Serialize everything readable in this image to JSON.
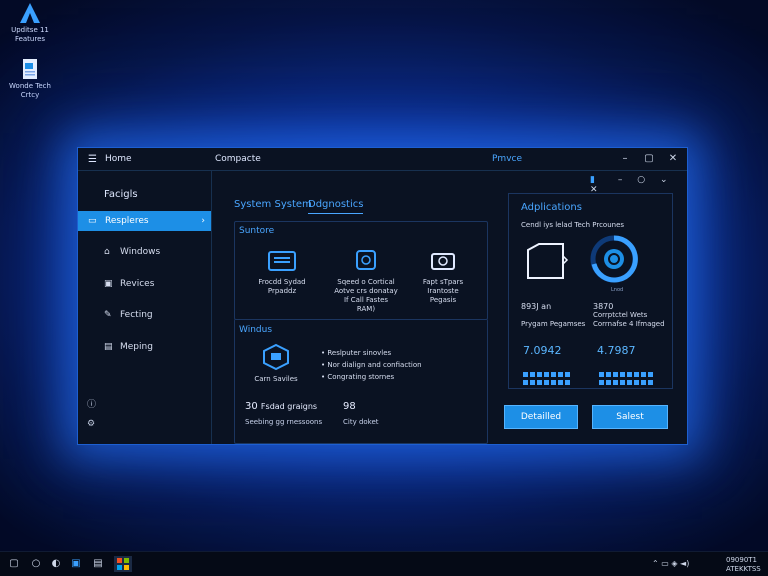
{
  "desktop": {
    "icons": [
      {
        "label1": "Upditse 11",
        "label2": "Features"
      },
      {
        "label1": "Wonde Tech",
        "label2": "Crtcy"
      }
    ]
  },
  "window": {
    "title_left": "Home",
    "title_center": "Compacte",
    "title_right": "Pmvce"
  },
  "sidebar": {
    "heading": "Facigls",
    "items": [
      {
        "label": "Respleres"
      },
      {
        "label": "Windows"
      },
      {
        "label": "Revices"
      },
      {
        "label": "Fecting"
      },
      {
        "label": "Meping"
      }
    ]
  },
  "main": {
    "tabs": [
      "System System",
      "Ddgnostics"
    ],
    "card1": {
      "title": "Suntore",
      "items": [
        {
          "line1": "Frocdd Sydad",
          "line2": "Prpaddz",
          "line3": ""
        },
        {
          "line1": "Sqeed o Cortical",
          "line2": "Aotve crs donatay",
          "line3": "If Call Fastes",
          "line4": "RAM)"
        },
        {
          "line1": "Fapt sTpars",
          "line2": "Irantoste",
          "line3": "Pegasis"
        }
      ]
    },
    "card2": {
      "title": "Windus",
      "icon_label": "Carn Saviles",
      "bullets": [
        "Reslputer sinovles",
        "Nor dialign and confiaction",
        "Congrating stornes"
      ],
      "stat1_num": "30",
      "stat1_text": "Fsdad graigns",
      "stat1_sub": "Seebing gg rnessoons",
      "stat2_num": "98",
      "stat2_sub": "City doket"
    }
  },
  "applications": {
    "heading": "Adplications",
    "subheading": "Cendl iys lelad Tech Prcounes",
    "ring_label": "Lnod",
    "left_num": "893J an",
    "left_sub": "Prygam Pegamses",
    "right_num": "3870",
    "right_sub1": "Corrptctel Wets",
    "right_sub2": "Corrnafse 4 Ifmaged",
    "big_left": "7.0942",
    "big_right": "4.7987",
    "btn_left": "Detailled",
    "btn_right": "Salest"
  },
  "tray": {
    "time": "09090T1",
    "date": "ATEKKTSS"
  },
  "colors": {
    "accent": "#1d8fe6",
    "link": "#4aa6ff",
    "window_bg": "#0a1222"
  }
}
